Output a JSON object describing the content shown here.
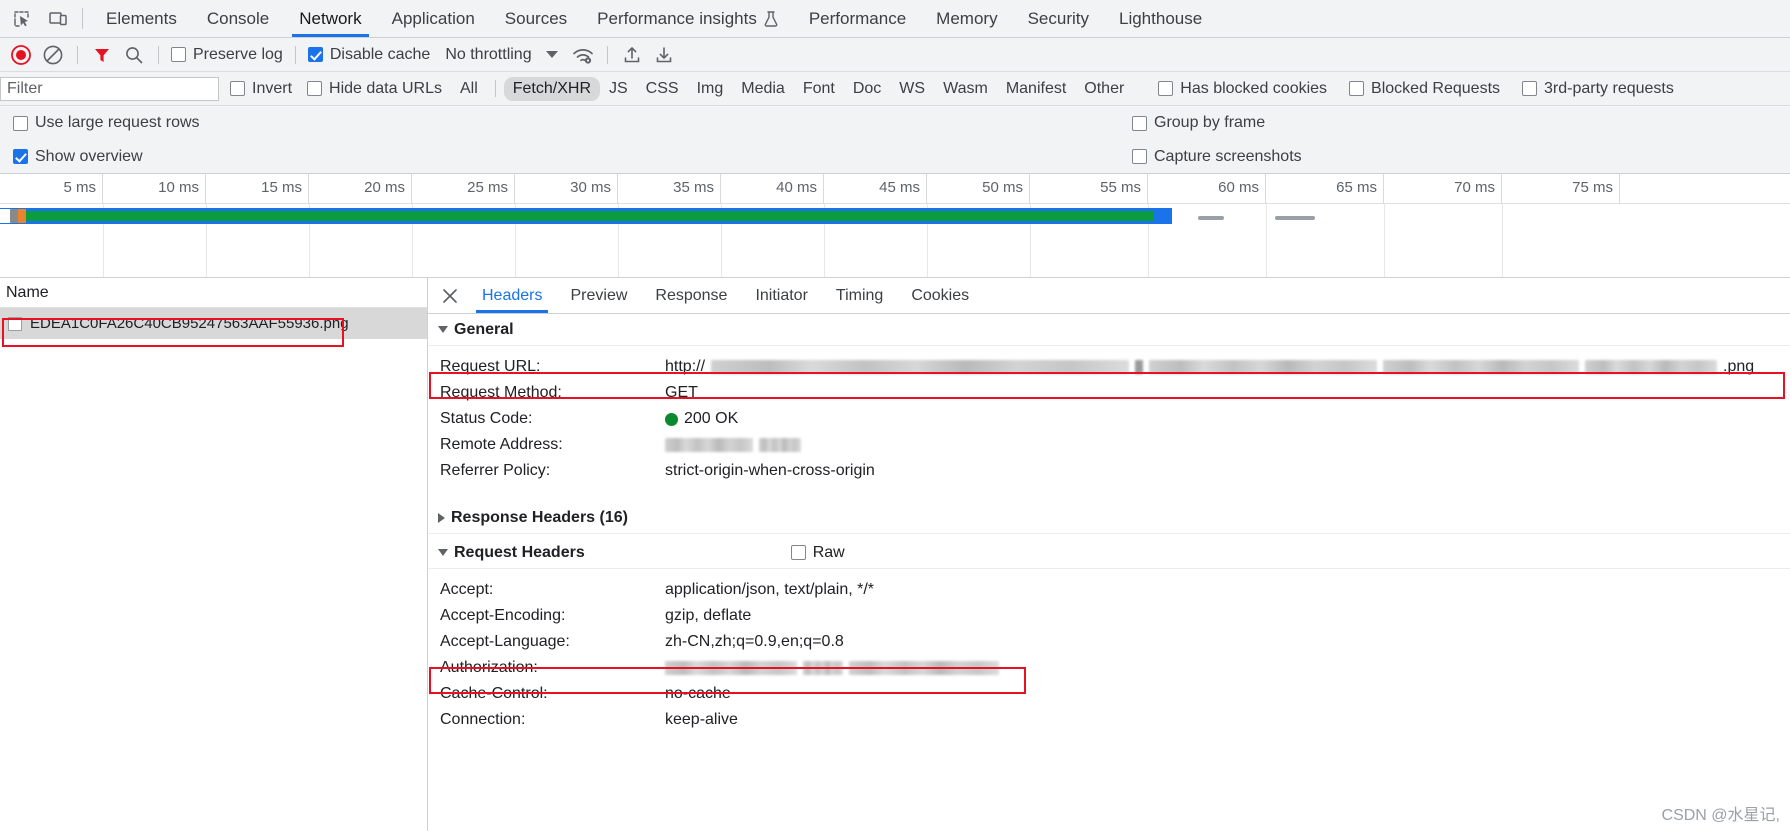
{
  "tabbar": {
    "icons": [
      "inspect-element-icon",
      "device-toolbar-icon"
    ],
    "tabs": [
      {
        "label": "Elements",
        "active": false
      },
      {
        "label": "Console",
        "active": false
      },
      {
        "label": "Network",
        "active": true
      },
      {
        "label": "Application",
        "active": false
      },
      {
        "label": "Sources",
        "active": false
      },
      {
        "label": "Performance insights",
        "active": false,
        "icon": "flask-icon"
      },
      {
        "label": "Performance",
        "active": false
      },
      {
        "label": "Memory",
        "active": false
      },
      {
        "label": "Security",
        "active": false
      },
      {
        "label": "Lighthouse",
        "active": false
      }
    ]
  },
  "toolbar": {
    "record_icon": "record-stop-icon",
    "clear_icon": "clear-icon",
    "filter_icon": "filter-funnel-icon",
    "search_icon": "search-icon",
    "preserve_log": {
      "label": "Preserve log",
      "checked": false
    },
    "disable_cache": {
      "label": "Disable cache",
      "checked": true
    },
    "throttling": {
      "value": "No throttling"
    },
    "network_conditions_icon": "wifi-settings-icon",
    "import_icon": "import-har-icon",
    "export_icon": "export-har-icon"
  },
  "filterbar": {
    "filter_placeholder": "Filter",
    "filter_value": "",
    "invert": {
      "label": "Invert",
      "checked": false
    },
    "hide_data_urls": {
      "label": "Hide data URLs",
      "checked": false
    },
    "types": [
      {
        "label": "All",
        "selected": false
      },
      {
        "label": "Fetch/XHR",
        "selected": true
      },
      {
        "label": "JS",
        "selected": false
      },
      {
        "label": "CSS",
        "selected": false
      },
      {
        "label": "Img",
        "selected": false
      },
      {
        "label": "Media",
        "selected": false
      },
      {
        "label": "Font",
        "selected": false
      },
      {
        "label": "Doc",
        "selected": false
      },
      {
        "label": "WS",
        "selected": false
      },
      {
        "label": "Wasm",
        "selected": false
      },
      {
        "label": "Manifest",
        "selected": false
      },
      {
        "label": "Other",
        "selected": false
      }
    ],
    "has_blocked_cookies": {
      "label": "Has blocked cookies",
      "checked": false
    },
    "blocked_requests": {
      "label": "Blocked Requests",
      "checked": false
    },
    "third_party": {
      "label": "3rd-party requests",
      "checked": false
    }
  },
  "settings": {
    "use_large_rows": {
      "label": "Use large request rows",
      "checked": false
    },
    "show_overview": {
      "label": "Show overview",
      "checked": true
    },
    "group_by_frame": {
      "label": "Group by frame",
      "checked": false
    },
    "capture_screenshots": {
      "label": "Capture screenshots",
      "checked": false
    }
  },
  "overview": {
    "ticks": [
      "5 ms",
      "10 ms",
      "15 ms",
      "20 ms",
      "25 ms",
      "30 ms",
      "35 ms",
      "40 ms",
      "45 ms",
      "50 ms",
      "55 ms",
      "60 ms",
      "65 ms",
      "70 ms",
      "75 ms"
    ],
    "colors": {
      "bar_outer": "#1a73e8",
      "bar_inner": "#0a9c3f",
      "segment_gray": "#8a8a8a",
      "segment_orange": "#e8842a"
    }
  },
  "requests": {
    "column_name": "Name",
    "rows": [
      {
        "name": "EDEA1C0FA26C40CB95247563AAF55936.png",
        "selected": true,
        "highlighted": true
      }
    ]
  },
  "details": {
    "close_icon": "close-icon",
    "tabs": [
      {
        "label": "Headers",
        "active": true
      },
      {
        "label": "Preview",
        "active": false
      },
      {
        "label": "Response",
        "active": false
      },
      {
        "label": "Initiator",
        "active": false
      },
      {
        "label": "Timing",
        "active": false
      },
      {
        "label": "Cookies",
        "active": false
      }
    ],
    "general": {
      "title": "General",
      "expanded": true,
      "rows": [
        {
          "key": "Request URL:",
          "value": "http://",
          "redacted": true,
          "value_suffix": ".png",
          "highlighted": true
        },
        {
          "key": "Request Method:",
          "value": "GET"
        },
        {
          "key": "Status Code:",
          "value": "200 OK",
          "status_dot": "green"
        },
        {
          "key": "Remote Address:",
          "value": "",
          "redacted": true
        },
        {
          "key": "Referrer Policy:",
          "value": "strict-origin-when-cross-origin"
        }
      ]
    },
    "response_headers": {
      "title": "Response Headers (16)",
      "expanded": false
    },
    "request_headers": {
      "title": "Request Headers",
      "expanded": true,
      "raw_toggle": {
        "label": "Raw",
        "checked": false
      },
      "rows": [
        {
          "key": "Accept:",
          "value": "application/json, text/plain, */*"
        },
        {
          "key": "Accept-Encoding:",
          "value": "gzip, deflate"
        },
        {
          "key": "Accept-Language:",
          "value": "zh-CN,zh;q=0.9,en;q=0.8"
        },
        {
          "key": "Authorization:",
          "value": "",
          "redacted": true,
          "highlighted": true
        },
        {
          "key": "Cache-Control:",
          "value": "no-cache"
        },
        {
          "key": "Connection:",
          "value": "keep-alive"
        }
      ]
    }
  },
  "watermark": "CSDN @水星记,"
}
